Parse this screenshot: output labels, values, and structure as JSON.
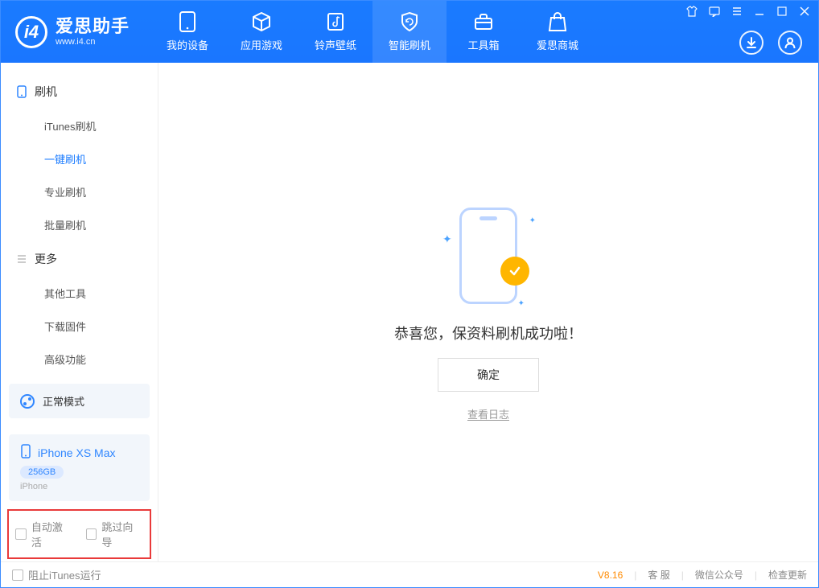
{
  "app": {
    "title_cn": "爱思助手",
    "title_en": "www.i4.cn"
  },
  "tabs": {
    "device": "我的设备",
    "apps": "应用游戏",
    "ring": "铃声壁纸",
    "flash": "智能刷机",
    "tools": "工具箱",
    "store": "爱思商城"
  },
  "sidebar": {
    "section_flash": "刷机",
    "items_flash": {
      "itunes": "iTunes刷机",
      "oneclick": "一键刷机",
      "pro": "专业刷机",
      "batch": "批量刷机"
    },
    "section_more": "更多",
    "items_more": {
      "other": "其他工具",
      "firmware": "下载固件",
      "advanced": "高级功能"
    }
  },
  "device_panel": {
    "mode": "正常模式",
    "name": "iPhone XS Max",
    "storage": "256GB",
    "type": "iPhone"
  },
  "options": {
    "auto_activate": "自动激活",
    "skip_guide": "跳过向导"
  },
  "content": {
    "success_msg": "恭喜您，保资料刷机成功啦！",
    "ok": "确定",
    "log": "查看日志"
  },
  "footer": {
    "block_itunes": "阻止iTunes运行",
    "version": "V8.16",
    "support": "客 服",
    "wechat": "微信公众号",
    "update": "检查更新"
  }
}
